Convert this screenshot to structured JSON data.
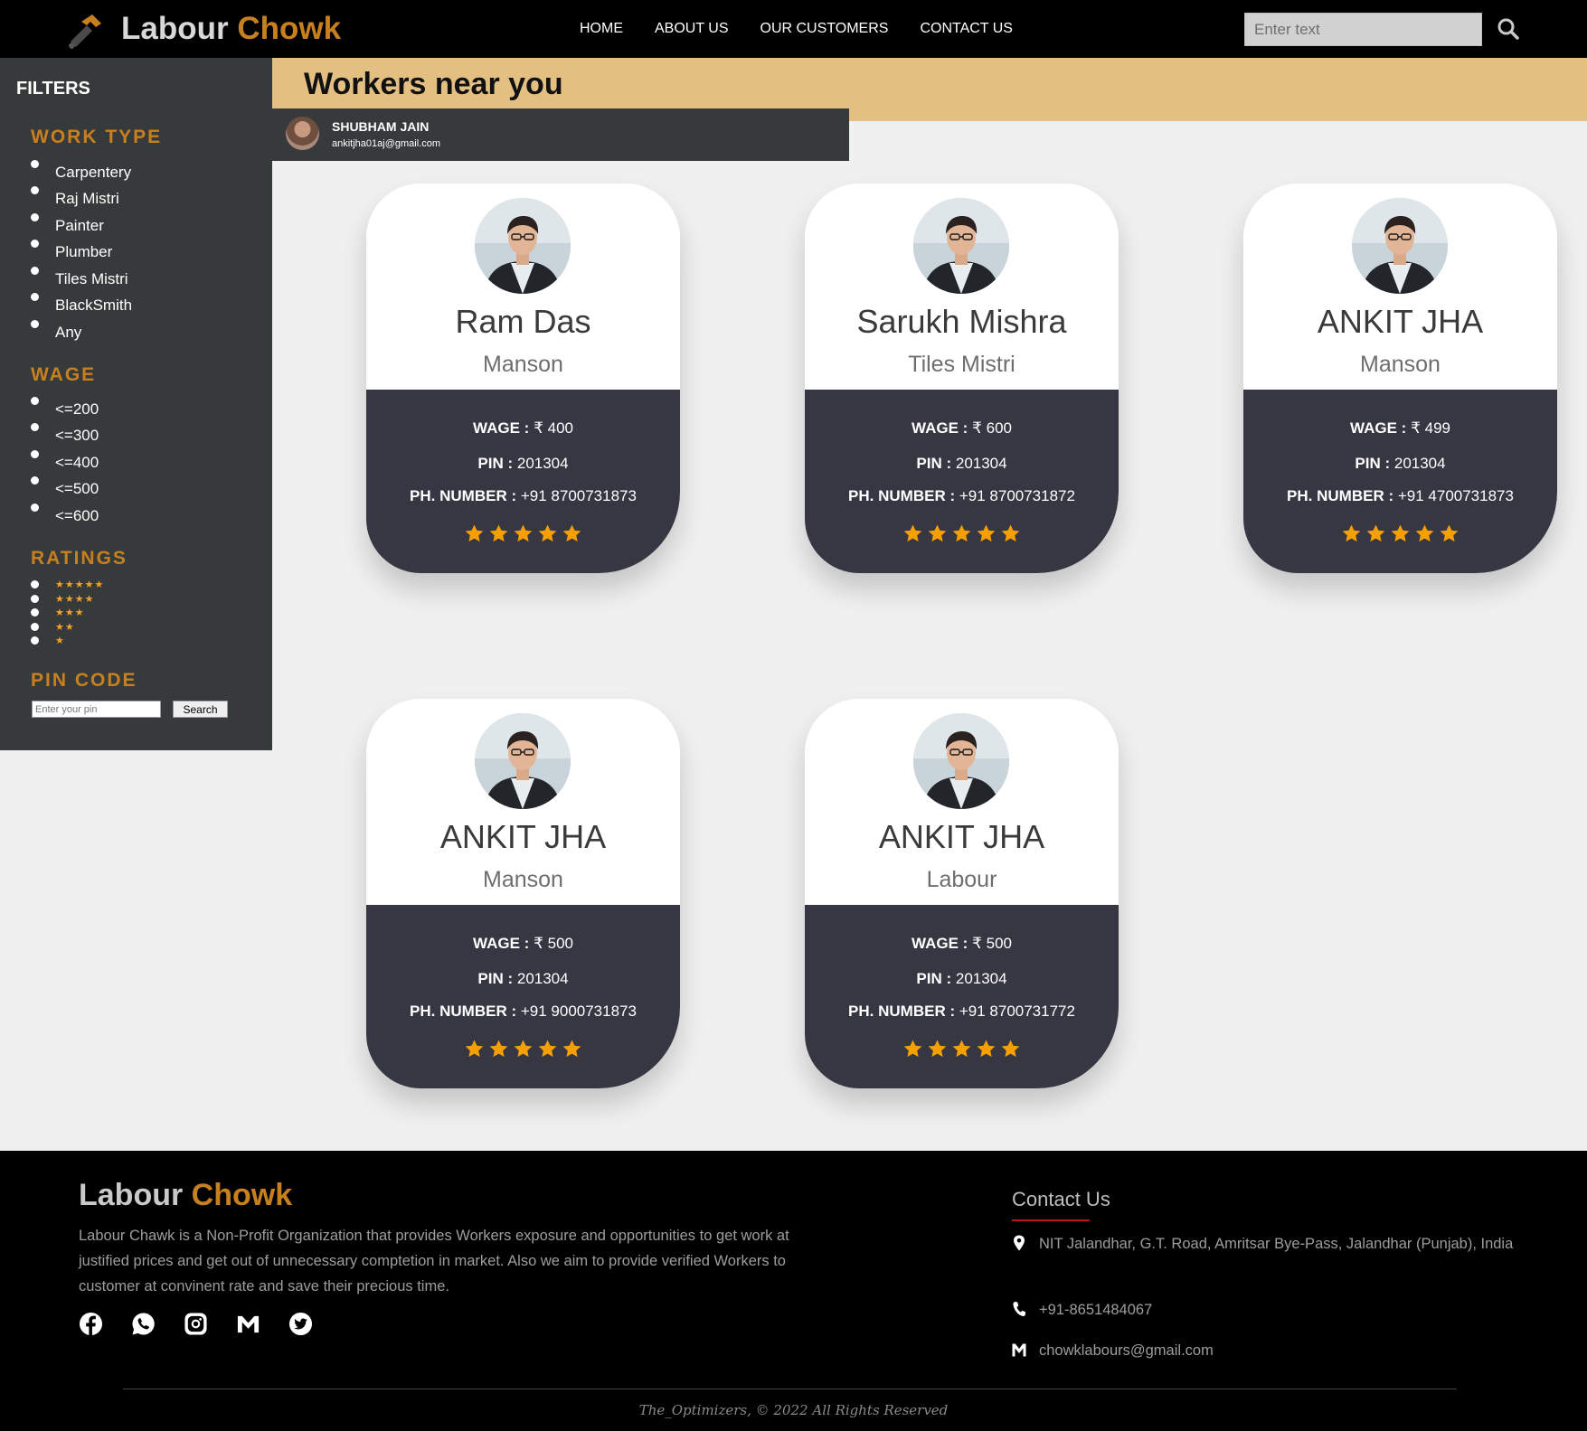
{
  "navbar": {
    "brand_main": "Labour",
    "brand_accent": "Chowk",
    "links": [
      "HOME",
      "ABOUT US",
      "OUR CUSTOMERS",
      "CONTACT US"
    ],
    "search_placeholder": "Enter text"
  },
  "sidebar": {
    "title": "FILTERS",
    "work_type": {
      "heading": "WORK TYPE",
      "options": [
        "Carpentery",
        "Raj Mistri",
        "Painter",
        "Plumber",
        "Tiles Mistri",
        "BlackSmith",
        "Any"
      ]
    },
    "wage": {
      "heading": "WAGE",
      "options": [
        "<=200",
        "<=300",
        "<=400",
        "<=500",
        "<=600"
      ]
    },
    "ratings": {
      "heading": "RATINGS",
      "options": [
        "★★★★★",
        "★★★★",
        "★★★",
        "★★",
        "★"
      ]
    },
    "pin_code": {
      "heading": "PIN CODE",
      "placeholder": "Enter your pin",
      "button": "Search"
    }
  },
  "main": {
    "title": "Workers near you",
    "user": {
      "name": "SHUBHAM JAIN",
      "email": "ankitjha01aj@gmail.com"
    },
    "labels": {
      "wage": "WAGE :",
      "pin": "PIN :",
      "phone": "PH. NUMBER :"
    },
    "workers": [
      {
        "name": "Ram Das",
        "trade": "Manson",
        "wage": "₹ 400",
        "pin": "201304",
        "phone": "+91 8700731873",
        "rating": 5
      },
      {
        "name": "Sarukh Mishra",
        "trade": "Tiles Mistri",
        "wage": "₹ 600",
        "pin": "201304",
        "phone": "+91 8700731872",
        "rating": 5
      },
      {
        "name": "ANKIT JHA",
        "trade": "Manson",
        "wage": "₹ 499",
        "pin": "201304",
        "phone": "+91 4700731873",
        "rating": 5
      },
      {
        "name": "ANKIT JHA",
        "trade": "Manson",
        "wage": "₹ 500",
        "pin": "201304",
        "phone": "+91 9000731873",
        "rating": 5
      },
      {
        "name": "ANKIT JHA",
        "trade": "Labour",
        "wage": "₹ 500",
        "pin": "201304",
        "phone": "+91 8700731772",
        "rating": 5
      }
    ]
  },
  "footer": {
    "brand_main": "Labour",
    "brand_accent": "Chowk",
    "description": "Labour Chawk is a Non-Profit Organization that provides Workers exposure and opportunities to get work at justified prices and get out of unnecessary comptetion in market. Also we aim to provide verified Workers to customer at convinent rate and save their precious time.",
    "socials": [
      "facebook-icon",
      "whatsapp-icon",
      "instagram-icon",
      "gmail-icon",
      "twitter-icon"
    ],
    "contact": {
      "title": "Contact Us",
      "address": "NIT Jalandhar, G.T. Road, Amritsar Bye-Pass, Jalandhar (Punjab), India",
      "phone": "+91-8651484067",
      "email": "chowklabours@gmail.com"
    },
    "copyright": "The_Optimizers, © 2022 All Rights Reserved"
  },
  "colors": {
    "accent": "#c8801f",
    "banner": "#e3bf82",
    "sidebar": "#363a3b",
    "card_dark": "#363743",
    "star": "#f5a000"
  }
}
